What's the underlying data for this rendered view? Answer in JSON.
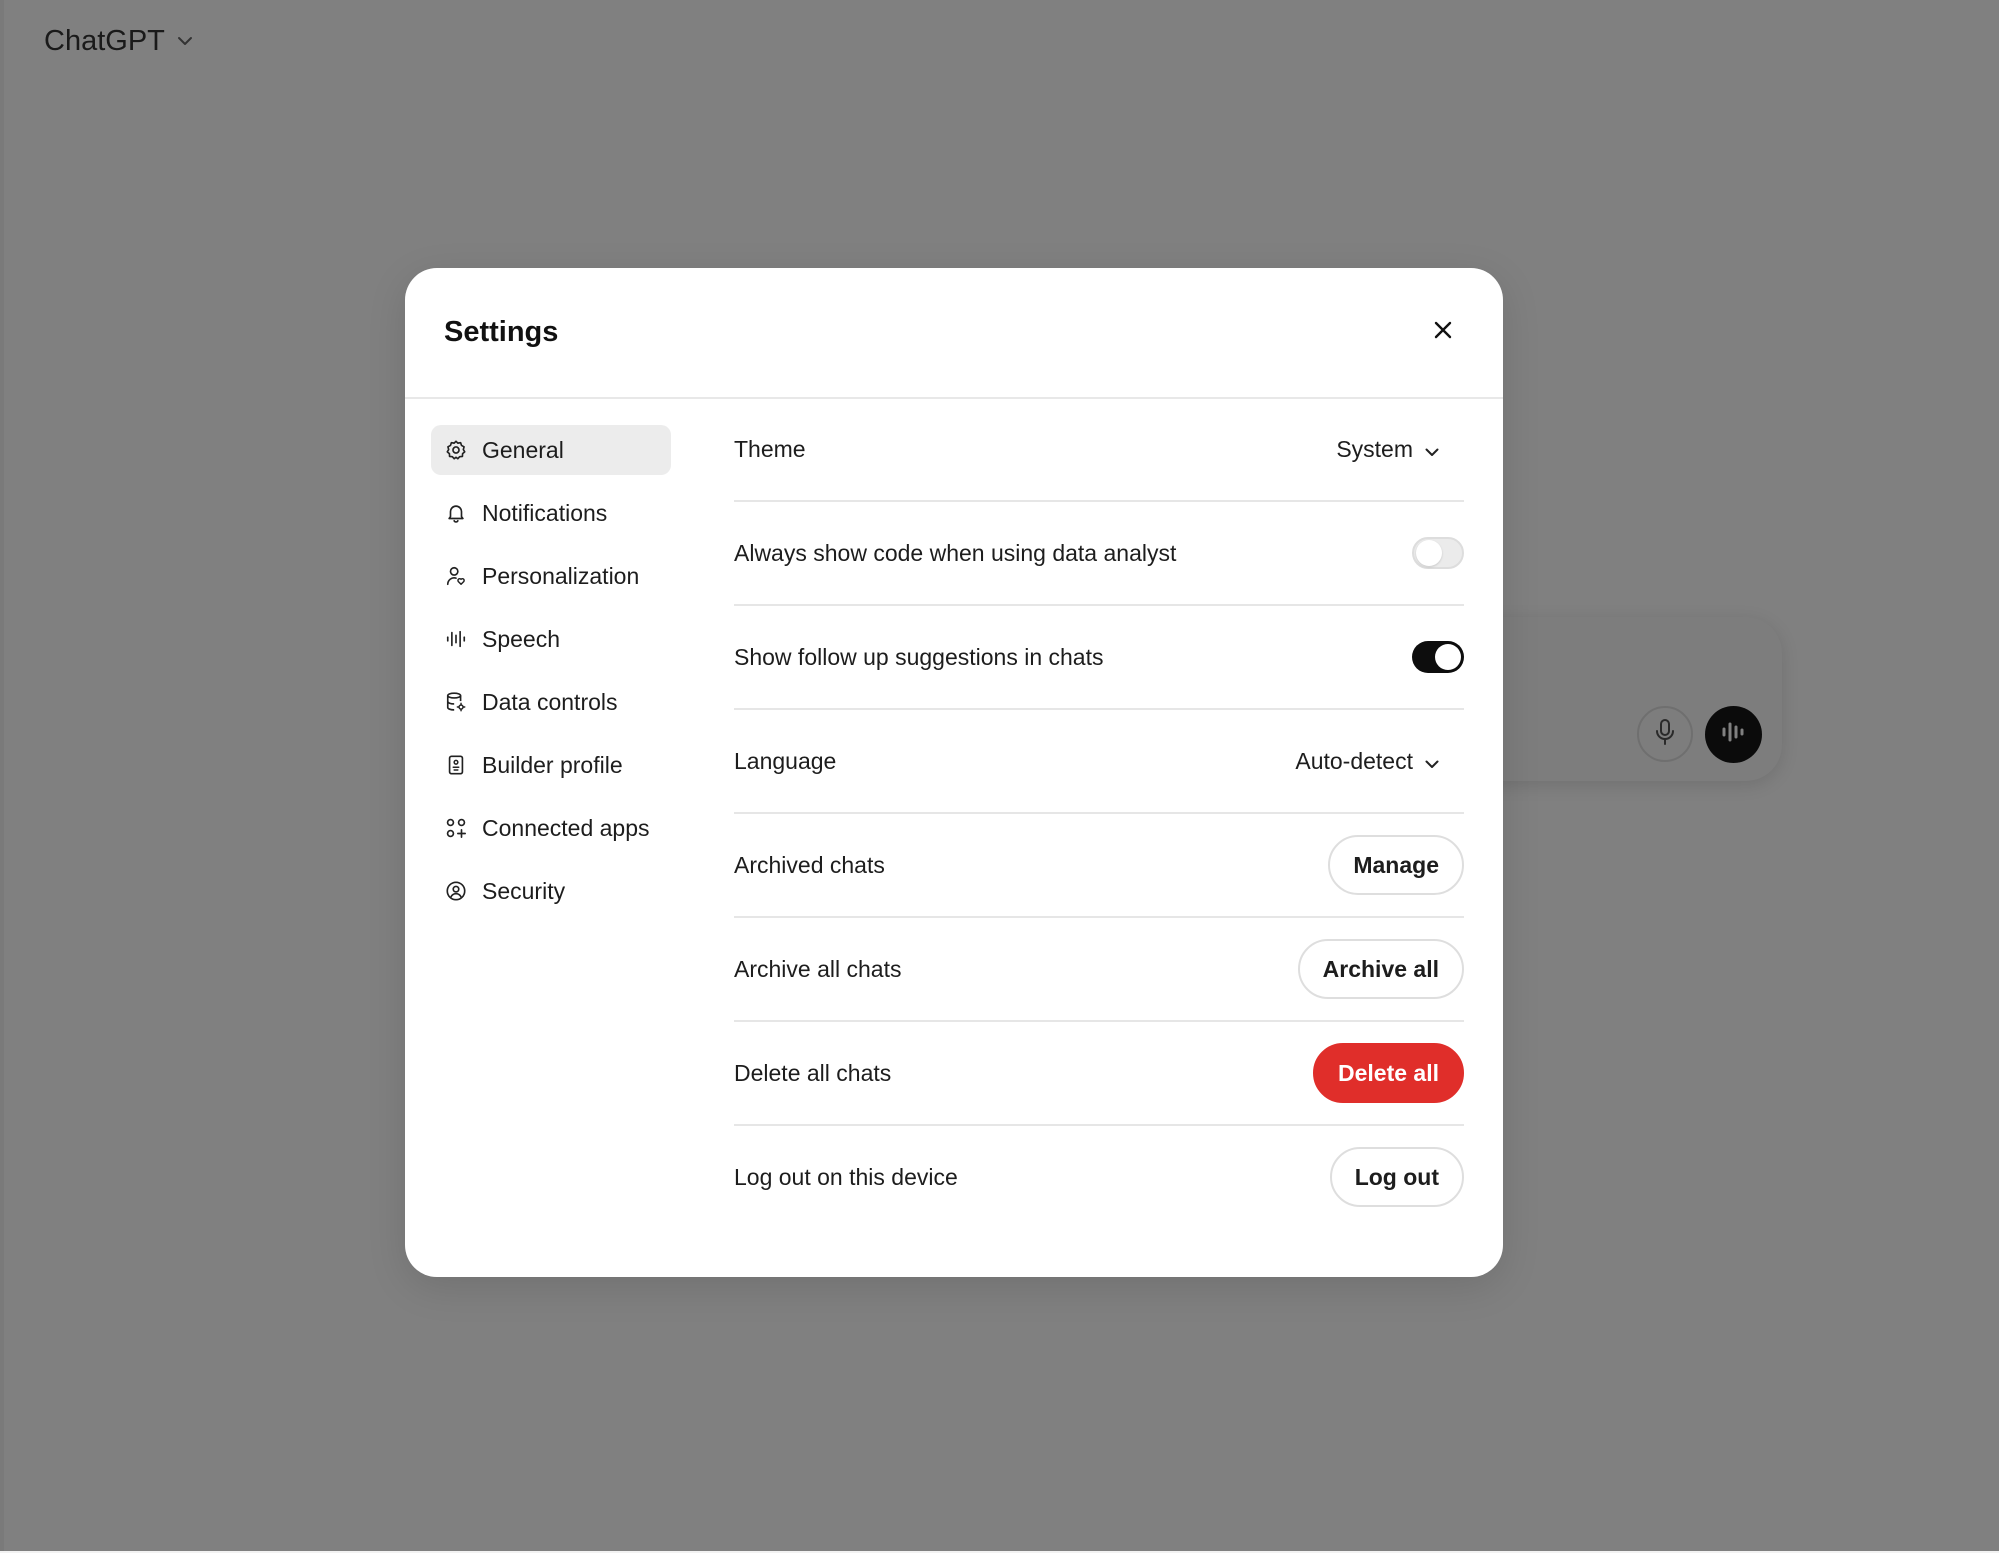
{
  "app": {
    "model_name": "ChatGPT"
  },
  "modal": {
    "title": "Settings"
  },
  "sidebar": {
    "items": [
      {
        "label": "General",
        "icon": "gear-icon",
        "active": true
      },
      {
        "label": "Notifications",
        "icon": "bell-icon"
      },
      {
        "label": "Personalization",
        "icon": "person-heart-icon"
      },
      {
        "label": "Speech",
        "icon": "waveform-icon"
      },
      {
        "label": "Data controls",
        "icon": "database-gear-icon"
      },
      {
        "label": "Builder profile",
        "icon": "id-badge-icon"
      },
      {
        "label": "Connected apps",
        "icon": "apps-grid-icon"
      },
      {
        "label": "Security",
        "icon": "shield-user-icon"
      }
    ]
  },
  "settings": {
    "theme": {
      "label": "Theme",
      "value": "System"
    },
    "always_show_code": {
      "label": "Always show code when using data analyst",
      "enabled": false
    },
    "follow_up": {
      "label": "Show follow up suggestions in chats",
      "enabled": true
    },
    "language": {
      "label": "Language",
      "value": "Auto-detect"
    },
    "archived_chats": {
      "label": "Archived chats",
      "button": "Manage"
    },
    "archive_all": {
      "label": "Archive all chats",
      "button": "Archive all"
    },
    "delete_all": {
      "label": "Delete all chats",
      "button": "Delete all"
    },
    "logout": {
      "label": "Log out on this device",
      "button": "Log out"
    }
  },
  "colors": {
    "overlay": "#808080",
    "danger": "#e02e2a",
    "toggle_on": "#0d0d0d",
    "active_nav": "#ececec"
  }
}
